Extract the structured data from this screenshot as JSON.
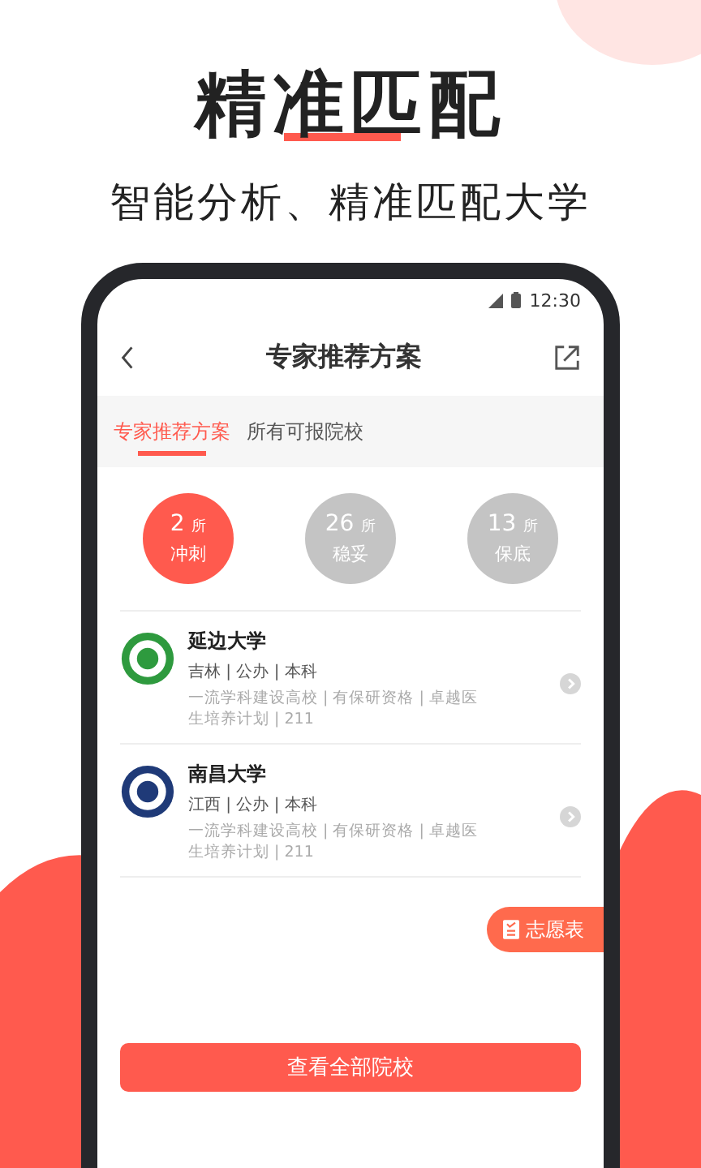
{
  "headline": "精准匹配",
  "subtitle": "智能分析、精准匹配大学",
  "status_bar": {
    "time": "12:30"
  },
  "nav": {
    "title": "专家推荐方案"
  },
  "tabs": [
    {
      "label": "专家推荐方案",
      "selected": true
    },
    {
      "label": "所有可报院校",
      "selected": false
    }
  ],
  "categories": [
    {
      "count": "2",
      "unit": "所",
      "label": "冲刺",
      "selected": true
    },
    {
      "count": "26",
      "unit": "所",
      "label": "稳妥",
      "selected": false
    },
    {
      "count": "13",
      "unit": "所",
      "label": "保底",
      "selected": false
    }
  ],
  "schools": [
    {
      "name": "延边大学",
      "meta": "吉林 | 公办 | 本科",
      "tags": "一流学科建设高校 | 有保研资格 | 卓越医生培养计划 | 211",
      "color": "#2e9a3e"
    },
    {
      "name": "南昌大学",
      "meta": "江西 | 公办 | 本科",
      "tags": "一流学科建设高校 | 有保研资格 | 卓越医生培养计划 | 211",
      "color": "#1f3a78"
    }
  ],
  "float_button": "志愿表",
  "bottom_button": "查看全部院校"
}
